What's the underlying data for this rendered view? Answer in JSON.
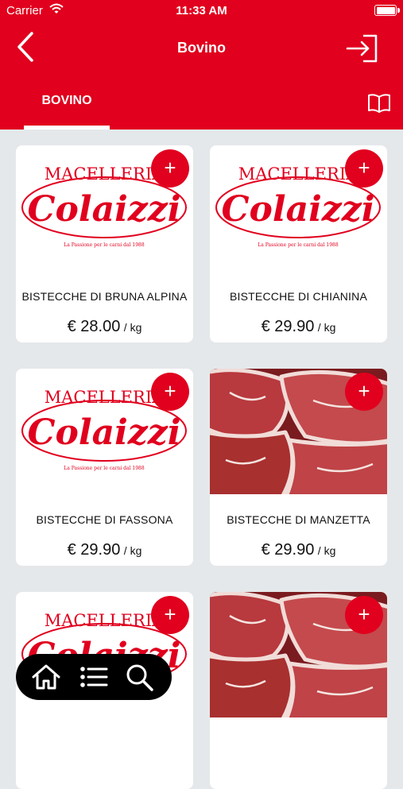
{
  "status_bar": {
    "carrier": "Carrier",
    "time": "11:33 AM"
  },
  "header": {
    "title": "Bovino",
    "tab_label": "BOVINO"
  },
  "logo": {
    "line1": "MACELLERIA",
    "line2": "Colaizzi",
    "tagline": "La Passione per le carni dal 1988"
  },
  "products": [
    {
      "name": "BISTECCHE DI BRUNA ALPINA",
      "price": "€ 28.00",
      "unit": "/ kg",
      "image": "logo"
    },
    {
      "name": "BISTECCHE DI CHIANINA",
      "price": "€ 29.90",
      "unit": "/ kg",
      "image": "logo"
    },
    {
      "name": "BISTECCHE DI FASSONA",
      "price": "€ 29.90",
      "unit": "/ kg",
      "image": "logo"
    },
    {
      "name": "BISTECCHE DI MANZETTA",
      "price": "€ 29.90",
      "unit": "/ kg",
      "image": "meat-photo"
    },
    {
      "name": "",
      "price": "",
      "unit": "",
      "image": "logo"
    },
    {
      "name": "",
      "price": "",
      "unit": "",
      "image": "meat-photo"
    }
  ],
  "add_button_label": "+",
  "icons": {
    "back": "chevron-left-icon",
    "login": "login-icon",
    "catalog": "book-icon",
    "home": "home-icon",
    "list": "list-icon",
    "search": "search-icon"
  },
  "colors": {
    "brand_red": "#e1001e",
    "background": "#e5e8ea",
    "nav_bar": "#000000"
  }
}
